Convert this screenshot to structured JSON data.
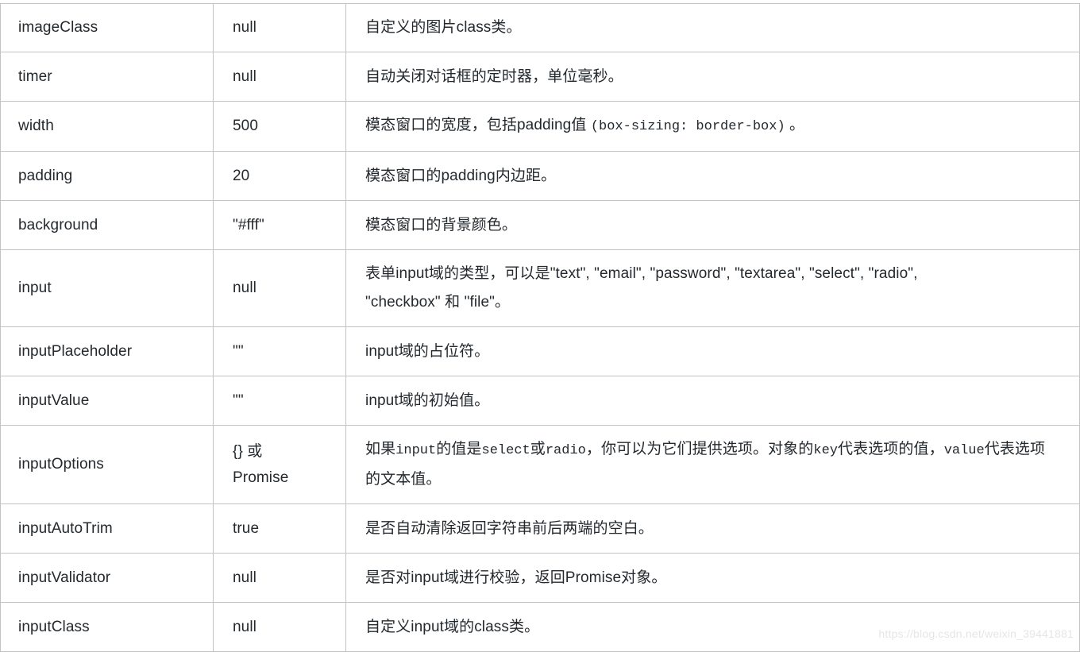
{
  "table": {
    "columns": [
      "name",
      "default",
      "description"
    ],
    "rows": [
      {
        "name": "imageClass",
        "default": "null",
        "desc_lines": [
          "自定义的图片class类。"
        ],
        "height_class": "r-h60"
      },
      {
        "name": "timer",
        "default": "null",
        "desc_lines": [
          "自动关闭对话框的定时器，单位毫秒。"
        ],
        "height_class": "r-h62"
      },
      {
        "name": "width",
        "default": "500",
        "desc_lines": [
          "模态窗口的宽度，包括padding值 (box-sizing: border-box) 。"
        ],
        "desc_mono_part": "(box-sizing: border-box)",
        "height_class": "r-h62"
      },
      {
        "name": "padding",
        "default": "20",
        "desc_lines": [
          "模态窗口的padding内边距。"
        ],
        "height_class": "r-h62"
      },
      {
        "name": "background",
        "default": "\"#fff\"",
        "desc_lines": [
          "模态窗口的背景颜色。"
        ],
        "height_class": "r-h62"
      },
      {
        "name": "input",
        "default": "null",
        "desc_lines": [
          "表单input域的类型，可以是\"text\", \"email\", \"password\", \"textarea\", \"select\", \"radio\",",
          "\"checkbox\" 和 \"file\"。"
        ],
        "height_class": "r-h84"
      },
      {
        "name": "inputPlaceholder",
        "default": "\"\"",
        "desc_lines": [
          "input域的占位符。"
        ],
        "height_class": "r-h62"
      },
      {
        "name": "inputValue",
        "default": "\"\"",
        "desc_lines": [
          "input域的初始值。"
        ],
        "height_class": "r-h62"
      },
      {
        "name": "inputOptions",
        "default": "{} 或 Promise",
        "desc_lines": [
          "如果input的值是select或radio，你可以为它们提供选项。对象的key代表选项的值，value代表选项",
          "的文本值。"
        ],
        "height_class": "r-h84"
      },
      {
        "name": "inputAutoTrim",
        "default": "true",
        "desc_lines": [
          "是否自动清除返回字符串前后两端的空白。"
        ],
        "height_class": "r-h62"
      },
      {
        "name": "inputValidator",
        "default": "null",
        "desc_lines": [
          "是否对input域进行校验，返回Promise对象。"
        ],
        "height_class": "r-h62"
      },
      {
        "name": "inputClass",
        "default": "null",
        "desc_lines": [
          "自定义input域的class类。"
        ],
        "height_class": "r-h62"
      }
    ]
  },
  "watermark": {
    "text": "https://blog.csdn.net/weixin_39441881"
  },
  "colors": {
    "border": "#c3c3c3",
    "text": "#24292e",
    "background": "#ffffff",
    "watermark": "#e6e6e6"
  }
}
